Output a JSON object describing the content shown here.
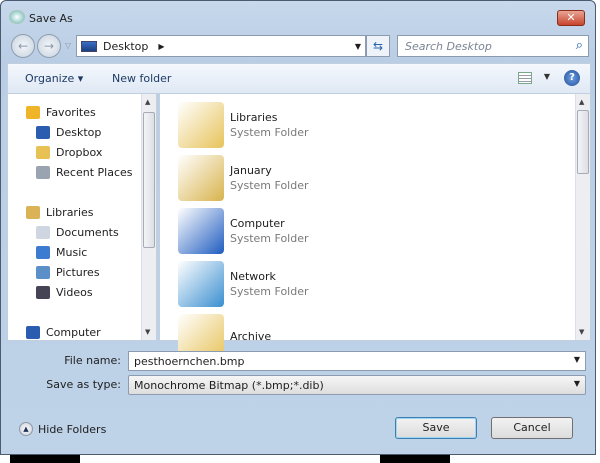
{
  "window": {
    "title": "Save As",
    "close": "✕"
  },
  "nav": {
    "back": "←",
    "forward": "→",
    "address": "Desktop",
    "search_placeholder": "Search Desktop"
  },
  "toolbar": {
    "organize": "Organize ▾",
    "new_folder": "New folder",
    "help": "?"
  },
  "sidebar": {
    "items": [
      {
        "label": "Favorites",
        "icon": "star-icon",
        "color": "#f0b429"
      },
      {
        "label": "Desktop",
        "icon": "desktop-icon",
        "color": "#2a5db0"
      },
      {
        "label": "Dropbox",
        "icon": "dropbox-icon",
        "color": "#e8c155"
      },
      {
        "label": "Recent Places",
        "icon": "recent-places-icon",
        "color": "#9aa3b0"
      },
      {
        "label": "Libraries",
        "icon": "libraries-icon",
        "color": "#d9b356"
      },
      {
        "label": "Documents",
        "icon": "documents-icon",
        "color": "#cfd6e2"
      },
      {
        "label": "Music",
        "icon": "music-icon",
        "color": "#3d7bd0"
      },
      {
        "label": "Pictures",
        "icon": "pictures-icon",
        "color": "#5a8fc8"
      },
      {
        "label": "Videos",
        "icon": "videos-icon",
        "color": "#445"
      },
      {
        "label": "Computer",
        "icon": "computer-icon",
        "color": "#2a5db0"
      }
    ]
  },
  "files": [
    {
      "name": "Libraries",
      "type": "System Folder",
      "icon": "libraries-folder-icon",
      "color": "#e7c35a"
    },
    {
      "name": "January",
      "type": "System Folder",
      "icon": "user-folder-icon",
      "color": "#d8b34d"
    },
    {
      "name": "Computer",
      "type": "System Folder",
      "icon": "computer-icon",
      "color": "#1f5cc0"
    },
    {
      "name": "Network",
      "type": "System Folder",
      "icon": "network-icon",
      "color": "#3a8ed0"
    },
    {
      "name": "Archive",
      "type": "",
      "icon": "folder-icon",
      "color": "#e7c35a"
    }
  ],
  "form": {
    "file_name_label": "File name:",
    "file_name": "pesthoernchen.bmp",
    "type_label": "Save as type:",
    "type_value": "Monochrome Bitmap (*.bmp;*.dib)"
  },
  "footer": {
    "hide_folders": "Hide Folders",
    "save": "Save",
    "cancel": "Cancel"
  }
}
